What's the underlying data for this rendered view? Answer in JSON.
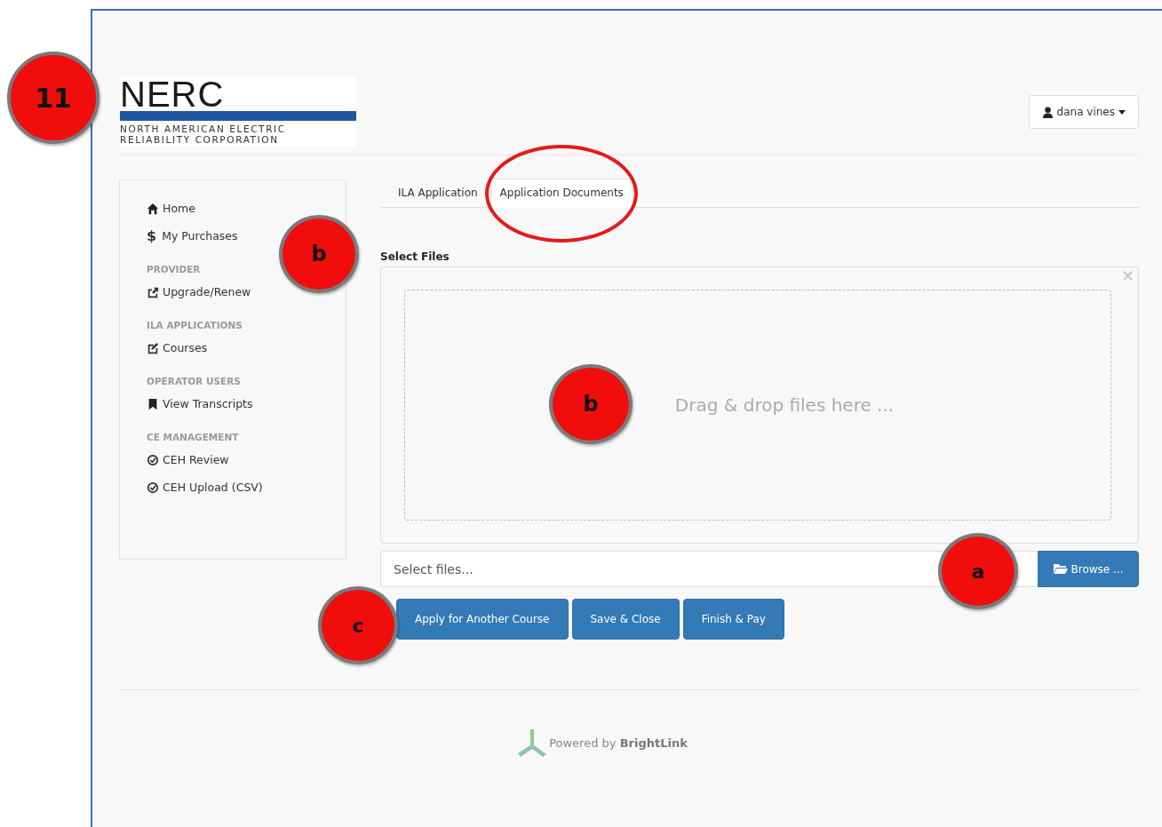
{
  "logo": {
    "wordmark": "NERC",
    "lines": [
      "NORTH AMERICAN ELECTRIC",
      "RELIABILITY CORPORATION"
    ]
  },
  "user_menu": {
    "label": "dana vines"
  },
  "sidebar": {
    "items": [
      {
        "kind": "link",
        "label": "Home"
      },
      {
        "kind": "link",
        "glyph": "$",
        "label": "My Purchases"
      },
      {
        "kind": "header",
        "label": "PROVIDER"
      },
      {
        "kind": "link",
        "label": "Upgrade/Renew"
      },
      {
        "kind": "header",
        "label": "ILA APPLICATIONS"
      },
      {
        "kind": "link",
        "label": "Courses"
      },
      {
        "kind": "header",
        "label": "OPERATOR USERS"
      },
      {
        "kind": "link",
        "label": "View Transcripts"
      },
      {
        "kind": "header",
        "label": "CE MANAGEMENT"
      },
      {
        "kind": "link",
        "label": "CEH Review"
      },
      {
        "kind": "link",
        "label": "CEH Upload (CSV)"
      }
    ]
  },
  "tabs": [
    {
      "label": "ILA Application",
      "selected": false,
      "circled": false
    },
    {
      "label": "Application Documents",
      "selected": true,
      "circled": true
    }
  ],
  "upload": {
    "label": "Select Files",
    "close": "×",
    "drop_text": "Drag & drop files here ...",
    "placeholder": "Select files...",
    "browse": "Browse ..."
  },
  "buttons": [
    "Apply for Another Course",
    "Save & Close",
    "Finish & Pay"
  ],
  "footer": {
    "text": "Powered by **BrightLink**"
  },
  "callouts": [
    {
      "label": "11"
    },
    {
      "label": "b"
    },
    {
      "label": "b"
    },
    {
      "label": "a"
    },
    {
      "label": "c"
    }
  ]
}
